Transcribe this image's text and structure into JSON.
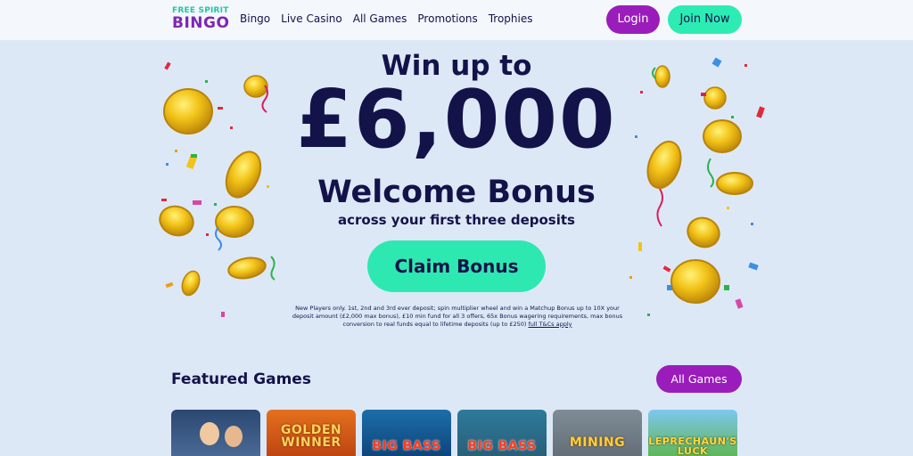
{
  "header": {
    "logo_line1": "FREE SPIRIT",
    "logo_line2": "BINGO",
    "nav": [
      "Bingo",
      "Live Casino",
      "All Games",
      "Promotions",
      "Trophies"
    ],
    "login_label": "Login",
    "join_label": "Join Now"
  },
  "hero": {
    "line1": "Win up to",
    "amount": "£6,000",
    "line3": "Welcome Bonus",
    "line4": "across your first three deposits",
    "cta_label": "Claim Bonus",
    "terms_text": "New Players only. 1st, 2nd and 3rd ever deposit; spin multiplier wheel and win a Matchup Bonus up to 10X your deposit amount (£2,000 max bonus), £10 min fund for all 3 offers, 65x Bonus wagering requirements, max bonus conversion to real funds equal to lifetime deposits (up to £250)",
    "terms_link": "full T&Cs apply"
  },
  "featured": {
    "title": "Featured Games",
    "all_games_label": "All Games",
    "games": [
      "",
      "GOLDEN WINNER",
      "BIG BASS",
      "BIG BASS",
      "MINING",
      "LEPRECHAUN'S LUCK"
    ]
  },
  "colors": {
    "background": "#dde8f7",
    "navy": "#13134a",
    "purple": "#9a1dbb",
    "mint": "#2ee8b2",
    "gold": "#f2c318"
  }
}
